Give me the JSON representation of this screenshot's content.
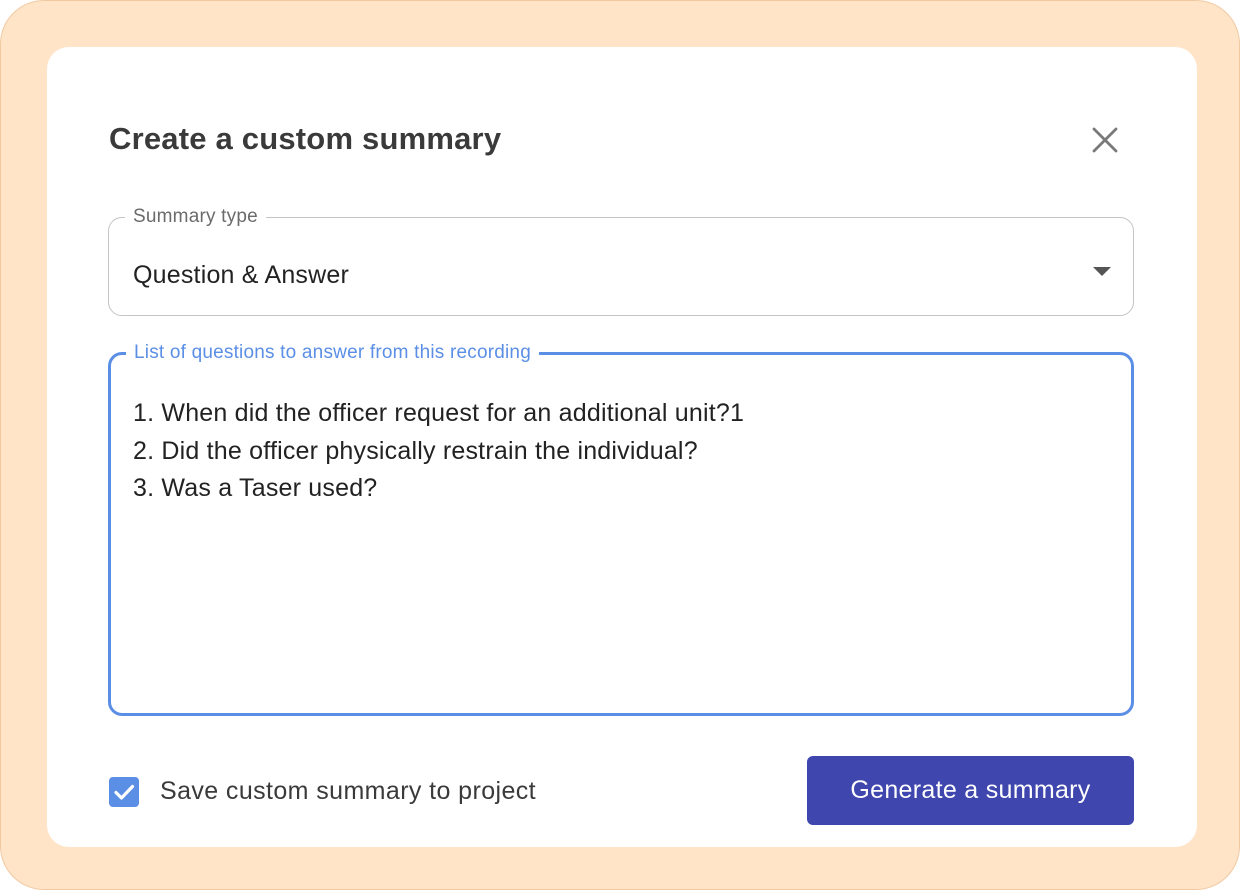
{
  "dialog": {
    "title": "Create a custom summary",
    "close_icon": "close-icon"
  },
  "summary_type": {
    "label": "Summary type",
    "value": "Question & Answer",
    "dropdown_icon": "caret-down-icon"
  },
  "questions": {
    "label": "List of questions to answer from this recording",
    "lines": [
      "1. When did the officer request for an additional unit?1",
      "2. Did the officer physically restrain the individual?",
      "3. Was a Taser used?"
    ]
  },
  "save_option": {
    "checked": true,
    "label": "Save custom summary to project",
    "check_icon": "checkmark-icon"
  },
  "actions": {
    "generate_label": "Generate a summary"
  },
  "colors": {
    "frame_background": "#ffe4c8",
    "accent_blue": "#5b8fe6",
    "primary_button": "#3f46ad"
  }
}
